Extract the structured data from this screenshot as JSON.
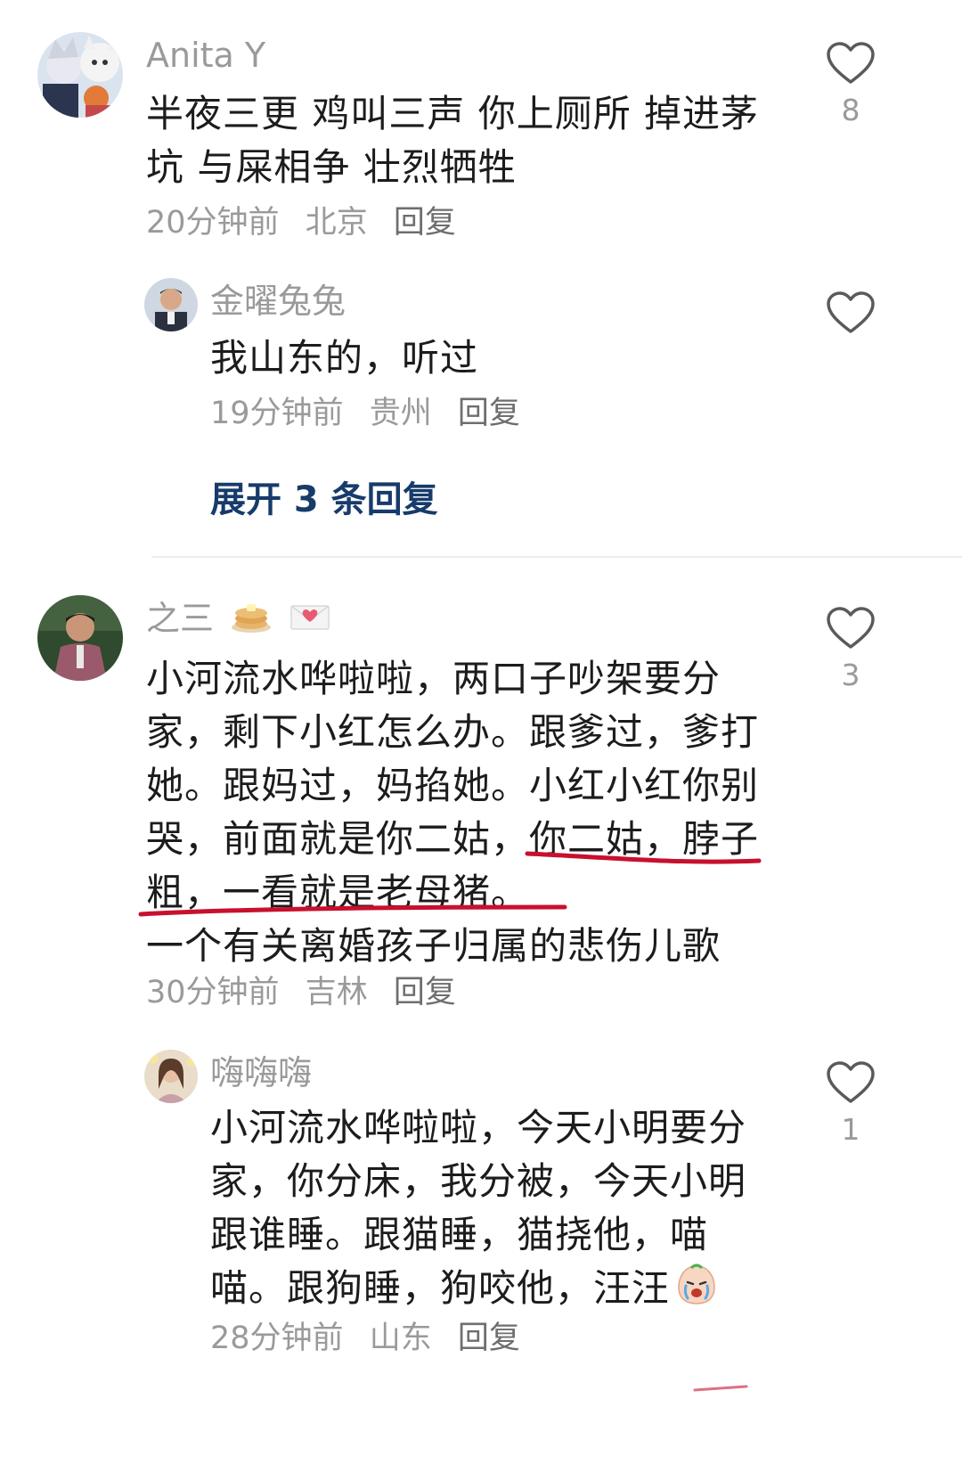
{
  "comments": [
    {
      "username": "Anita Y",
      "lines": [
        "半夜三更 鸡叫三声 你上厕所 掉进茅",
        "坑 与屎相争 壮烈牺牲"
      ],
      "time": "20分钟前",
      "location": "北京",
      "reply_label": "回复",
      "likes": "8",
      "replies": [
        {
          "username": "金曜兔兔",
          "lines": [
            "我山东的，听过"
          ],
          "time": "19分钟前",
          "location": "贵州",
          "reply_label": "回复",
          "likes": ""
        }
      ],
      "expand_label": "展开 3 条回复"
    },
    {
      "username": "之三",
      "username_icons": [
        "pancake-emoji-icon",
        "heart-envelope-icon"
      ],
      "lines": [
        "小河流水哗啦啦，两口子吵架要分",
        "家，剩下小红怎么办。跟爹过，爹打",
        "她。跟妈过，妈掐她。小红小红你别",
        "哭，前面就是你二姑，你二姑，脖子",
        "粗，一看就是老母猪。",
        "一个有关离婚孩子归属的悲伤儿歌"
      ],
      "time": "30分钟前",
      "location": "吉林",
      "reply_label": "回复",
      "likes": "3",
      "underline_color": "#c8102e",
      "replies": [
        {
          "username": "嗨嗨嗨",
          "lines": [
            "小河流水哗啦啦，今天小明要分",
            "家，你分床，我分被，今天小明",
            "跟谁睡。跟猫睡，猫挠他，喵",
            "喵。跟狗睡，狗咬他，汪汪"
          ],
          "trailing_icon": "crying-emoji-icon",
          "time": "28分钟前",
          "location": "山东",
          "reply_label": "回复",
          "likes": "1"
        }
      ]
    }
  ]
}
